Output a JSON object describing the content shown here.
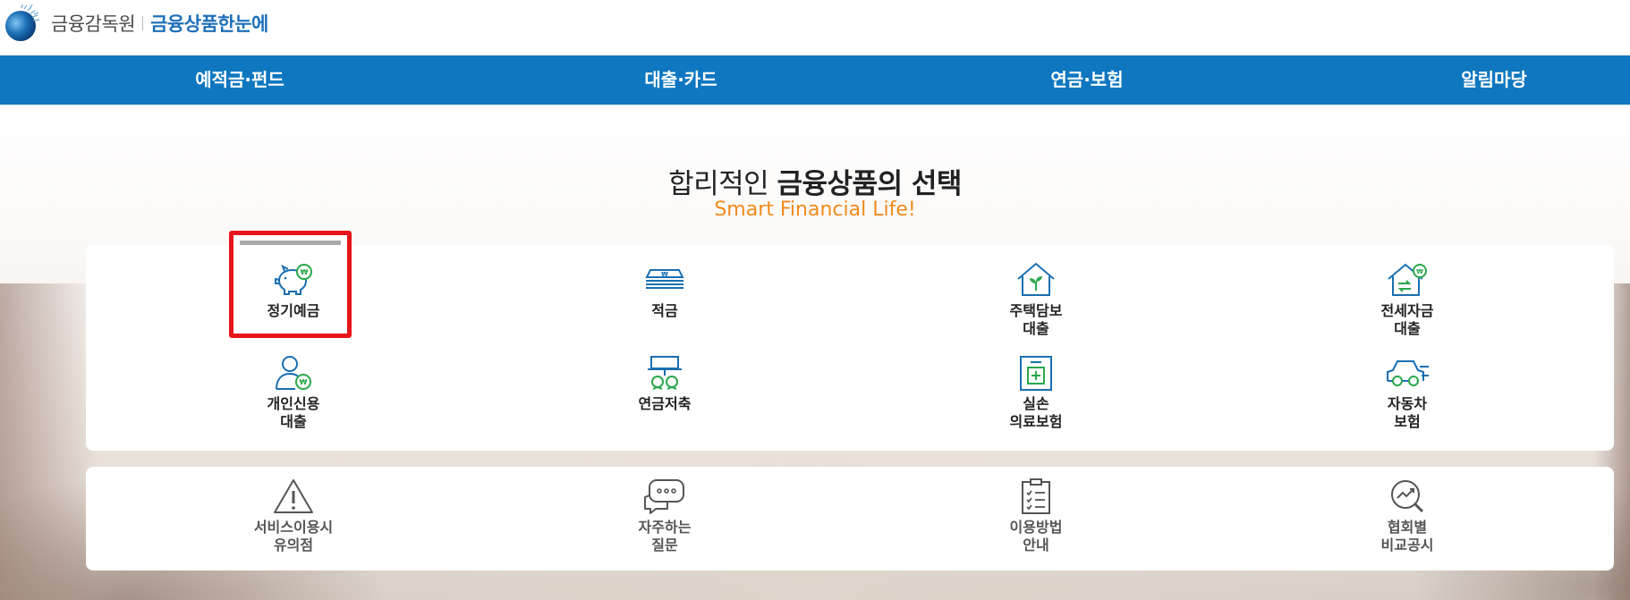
{
  "header": {
    "org_name": "금융감독원",
    "service_name": "금융상품한눈에"
  },
  "nav": {
    "items": [
      {
        "label": "예적금·펀드"
      },
      {
        "label": "대출·카드"
      },
      {
        "label": "연금·보험"
      },
      {
        "label": "알림마당"
      }
    ]
  },
  "hero": {
    "headline_light": "합리적인 ",
    "headline_bold": "금융상품의 선택",
    "subline": "Smart Financial Life!"
  },
  "products": [
    {
      "label": "정기예금",
      "icon": "piggy-bank-icon"
    },
    {
      "label": "적금",
      "icon": "money-stack-icon"
    },
    {
      "label": "주택담보\n대출",
      "icon": "house-sprout-icon"
    },
    {
      "label": "전세자금\n대출",
      "icon": "house-exchange-icon"
    },
    {
      "label": "개인신용\n대출",
      "icon": "person-won-icon"
    },
    {
      "label": "연금저축",
      "icon": "pension-icon"
    },
    {
      "label": "실손\n의료보험",
      "icon": "medical-kit-icon"
    },
    {
      "label": "자동차\n보험",
      "icon": "car-icon"
    }
  ],
  "info": [
    {
      "label": "서비스이용시\n유의점",
      "icon": "warning-icon"
    },
    {
      "label": "자주하는\n질문",
      "icon": "chat-bubble-icon"
    },
    {
      "label": "이용방법\n안내",
      "icon": "clipboard-check-icon"
    },
    {
      "label": "협회별\n비교공시",
      "icon": "search-chart-icon"
    }
  ],
  "colors": {
    "nav_bg": "#0f77c0",
    "brand_blue": "#1d6fb8",
    "accent_orange": "#f08a1c",
    "icon_blue": "#1a6fb0",
    "icon_green": "#2aa84a",
    "highlight_red": "#e8141b"
  }
}
